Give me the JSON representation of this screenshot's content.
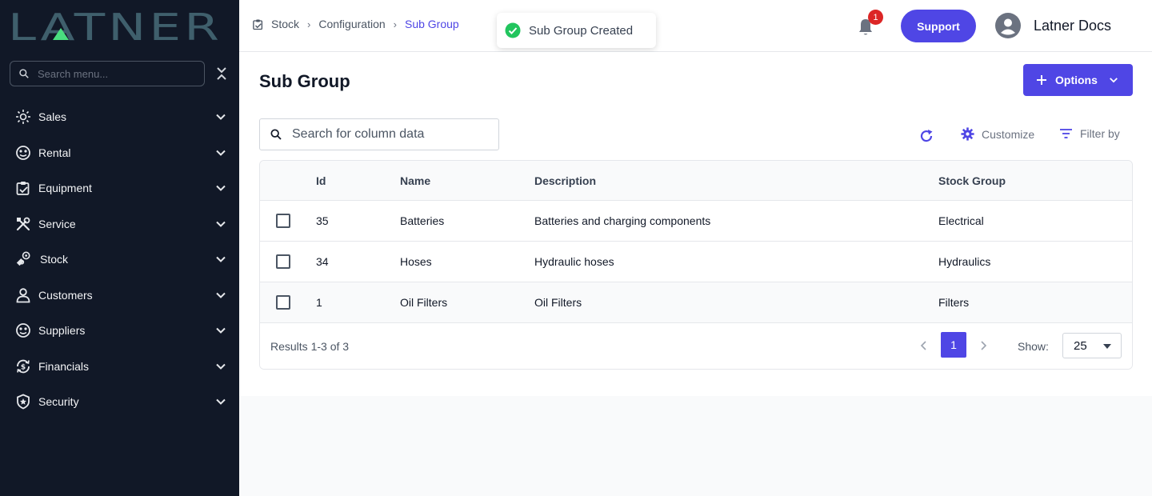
{
  "sidebar": {
    "logo_text": "LATNER",
    "search_placeholder": "Search menu...",
    "items": [
      {
        "label": "Sales",
        "icon": "sales-icon"
      },
      {
        "label": "Rental",
        "icon": "rental-icon"
      },
      {
        "label": "Equipment",
        "icon": "equipment-icon"
      },
      {
        "label": "Service",
        "icon": "service-icon"
      },
      {
        "label": "Stock",
        "icon": "stock-icon"
      },
      {
        "label": "Customers",
        "icon": "customers-icon"
      },
      {
        "label": "Suppliers",
        "icon": "suppliers-icon"
      },
      {
        "label": "Financials",
        "icon": "financials-icon"
      },
      {
        "label": "Security",
        "icon": "security-icon"
      }
    ]
  },
  "header": {
    "breadcrumb": [
      "Stock",
      "Configuration",
      "Sub Group"
    ],
    "toast": "Sub Group Created",
    "notification_count": "1",
    "support_label": "Support",
    "user_name": "Latner Docs"
  },
  "main": {
    "title": "Sub Group",
    "options_label": "Options",
    "search_placeholder": "Search for column data",
    "customize_label": "Customize",
    "filter_label": "Filter by",
    "columns": [
      "Id",
      "Name",
      "Description",
      "Stock Group"
    ],
    "rows": [
      {
        "id": "35",
        "name": "Batteries",
        "description": "Batteries and charging components",
        "group": "Electrical"
      },
      {
        "id": "34",
        "name": "Hoses",
        "description": "Hydraulic hoses",
        "group": "Hydraulics"
      },
      {
        "id": "1",
        "name": "Oil Filters",
        "description": "Oil Filters",
        "group": "Filters"
      }
    ],
    "results_text": "Results 1-3 of 3",
    "current_page": "1",
    "show_label": "Show:",
    "page_size": "25"
  },
  "colors": {
    "accent": "#4f46e5",
    "sidebar_bg": "#111827",
    "success": "#22c55e",
    "badge": "#dc2626"
  }
}
